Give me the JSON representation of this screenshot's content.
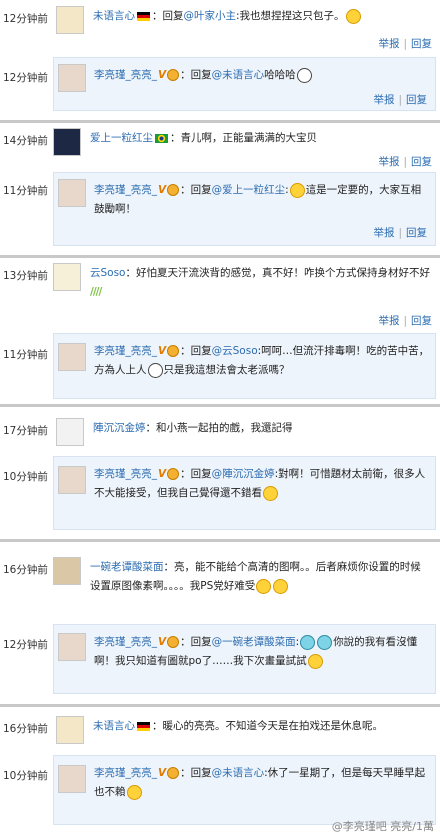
{
  "threads": [
    {
      "main": {
        "time": "12分钟前",
        "user": "未语言心",
        "flag": "de",
        "pre": "：回复",
        "mention": "@叶家小主",
        "text": ":我也想捏捏这只包子。",
        "emoji": "smile"
      },
      "reply": {
        "time": "12分钟前",
        "user": "李亮瑾_亮亮_",
        "pre": "：回复",
        "mention": "@未语言心",
        "text": "哈哈哈",
        "emoji": "panda"
      }
    },
    {
      "main": {
        "time": "14分钟前",
        "user": "爱上一粒红尘",
        "flag": "br",
        "text": "：青儿啊，正能量满满的大宝贝"
      },
      "reply": {
        "time": "11分钟前",
        "user": "李亮瑾_亮亮_",
        "pre": "：回复",
        "mention": "@爱上一粒红尘",
        "text1": ":",
        "text2": "這是一定要的，大家互相鼓勵啊！",
        "emoji": "smile"
      }
    },
    {
      "main": {
        "time": "13分钟前",
        "user": "云Soso",
        "text": "：好怕夏天汗流浹背的感觉，真不好！咋换个方式保持身材好不好",
        "grass": "////"
      },
      "reply": {
        "time": "11分钟前",
        "user": "李亮瑾_亮亮_",
        "pre": "：回复",
        "mention": "@云Soso",
        "text": ":呵呵…但流汗排毒啊！吃的苦中苦，方為人上人",
        "text2": "只是我這想法會太老派嗎？",
        "emoji": "panda"
      }
    },
    {
      "main": {
        "time": "17分钟前",
        "user": "陣沉沉金婷",
        "text": "：和小燕一起拍的戲，我還記得"
      },
      "reply": {
        "time": "10分钟前",
        "user": "李亮瑾_亮亮_",
        "pre": "：回复",
        "mention": "@陣沉沉金婷",
        "text": ":對啊！可惜題材太前衛，很多人不大能接受，但我自己覺得還不錯看",
        "emoji": "sad"
      }
    },
    {
      "main": {
        "time": "16分钟前",
        "user": "一碗老谭酸菜面",
        "text": "：亮，能不能给个高清的图啊。。后者麻烦你设置的时候设置原图像素啊。。。。我PS党好难受"
      },
      "reply": {
        "time": "12分钟前",
        "user": "李亮瑾_亮亮_",
        "pre": "：回复",
        "mention": "@一碗老谭酸菜面",
        "text1": ":",
        "text2": "你說的我有看沒懂啊！我只知道有圖就po了……我下次畫量試試"
      }
    },
    {
      "main": {
        "time": "16分钟前",
        "user": "未语言心",
        "flag": "de",
        "text": "：暖心的亮亮。不知道今天是在拍戏还是休息呢。"
      },
      "reply": {
        "time": "10分钟前",
        "user": "李亮瑾_亮亮_",
        "pre": "：回复",
        "mention": "@未语言心",
        "text": ":休了一星期了，但是每天早睡早起也不賴",
        "emoji": "smile"
      }
    }
  ],
  "actions": {
    "report": "举报",
    "reply": "回复",
    "sep": "|"
  },
  "vip_mark": "V",
  "watermark": "@李亮瑾吧 亮亮/1萬",
  "colors": {
    "link": "#2b6cb0",
    "reply_bg": "#eef4fb",
    "divider": "#c8c8c8"
  }
}
